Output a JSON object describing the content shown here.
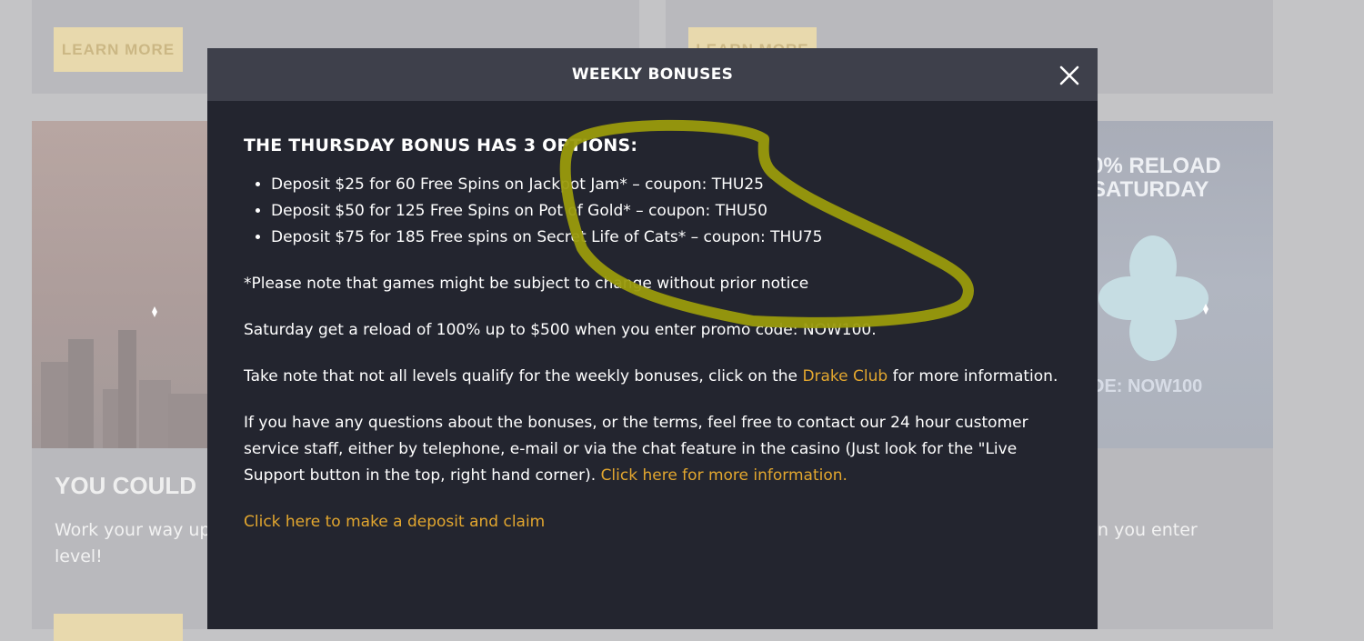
{
  "background": {
    "learn_more_label": "LEARN MORE",
    "left_card_heading": "YOU COULD",
    "left_card_text_line1": "Work your way up",
    "left_card_text_line2": "level!",
    "right_card_reload_line1": "0% RELOAD",
    "right_card_reload_line2": "SATURDAY",
    "right_card_code_label": "DE:",
    "right_card_code_value": "NOW100",
    "right_card_text": "n you enter"
  },
  "modal": {
    "title": "WEEKLY BONUSES",
    "close_icon": "close-icon",
    "heading": "THE THURSDAY BONUS HAS 3 OPTIONS:",
    "options": [
      "Deposit $25 for 60 Free Spins on Jackpot Jam* – coupon: THU25",
      "Deposit $50 for 125 Free Spins on Pot of Gold* – coupon: THU50",
      "Deposit $75 for 185 Free spins on Secret Life of Cats* – coupon: THU75"
    ],
    "note": "*Please note that games might be subject to change without prior notice",
    "saturday_text": "Saturday get a reload of 100% up to $500 when you enter promo code: NOW100.",
    "levels_text_before": "Take note that not all levels qualify for the weekly bonuses, click on the ",
    "levels_link": "Drake Club",
    "levels_text_after": " for more information.",
    "contact_text": "If you have any questions about the bonuses, or the terms, feel free to contact our 24 hour customer service staff, either by telephone, e-mail or via the chat feature in the casino (Just look for the \"Live Support button in the top, right hand corner). ",
    "contact_link": "Click here for more information.",
    "deposit_link": "Click here to make a deposit and claim"
  },
  "colors": {
    "modal_bg": "#23252f",
    "header_bg": "#3e404b",
    "link": "#e3a72f",
    "scribble": "#9a9a0c"
  }
}
